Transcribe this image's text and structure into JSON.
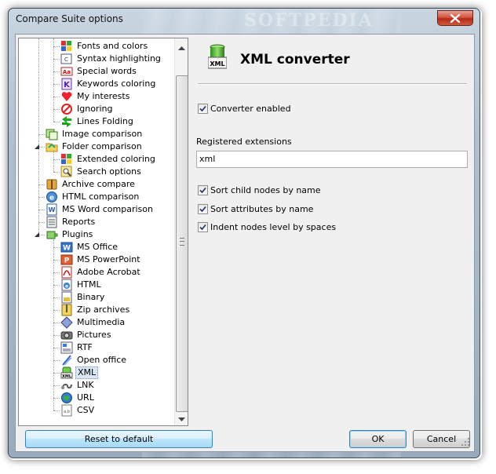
{
  "window": {
    "title": "Compare Suite options",
    "watermark": "SOFTPEDIA"
  },
  "tree": {
    "items": [
      {
        "label": "Fonts and colors",
        "icon": "palette-icon",
        "level": 2
      },
      {
        "label": "Syntax highlighting",
        "icon": "syntax-icon",
        "level": 2
      },
      {
        "label": "Special words",
        "icon": "special-words-icon",
        "level": 2
      },
      {
        "label": "Keywords coloring",
        "icon": "keywords-icon",
        "level": 2
      },
      {
        "label": "My interests",
        "icon": "heart-icon",
        "level": 2
      },
      {
        "label": "Ignoring",
        "icon": "ignore-icon",
        "level": 2
      },
      {
        "label": "Lines Folding",
        "icon": "folding-arrows-icon",
        "level": 2
      },
      {
        "label": "Image comparison",
        "icon": "image-compare-icon",
        "level": 1
      },
      {
        "label": "Folder comparison",
        "icon": "folder-compare-icon",
        "level": 1,
        "expanded": true
      },
      {
        "label": "Extended coloring",
        "icon": "palette-icon",
        "level": 2
      },
      {
        "label": "Search options",
        "icon": "search-options-icon",
        "level": 2
      },
      {
        "label": "Archive compare",
        "icon": "archive-icon",
        "level": 1
      },
      {
        "label": "HTML comparison",
        "icon": "html-compare-icon",
        "level": 1
      },
      {
        "label": "MS Word comparison",
        "icon": "word-compare-icon",
        "level": 1
      },
      {
        "label": "Reports",
        "icon": "reports-icon",
        "level": 1
      },
      {
        "label": "Plugins",
        "icon": "plugins-icon",
        "level": 1,
        "expanded": true
      },
      {
        "label": "MS Office",
        "icon": "ms-office-icon",
        "level": 2
      },
      {
        "label": "MS PowerPoint",
        "icon": "powerpoint-icon",
        "level": 2
      },
      {
        "label": "Adobe Acrobat",
        "icon": "acrobat-icon",
        "level": 2
      },
      {
        "label": "HTML",
        "icon": "html-icon",
        "level": 2
      },
      {
        "label": "Binary",
        "icon": "binary-icon",
        "level": 2
      },
      {
        "label": "Zip archives",
        "icon": "zip-icon",
        "level": 2
      },
      {
        "label": "Multimedia",
        "icon": "multimedia-icon",
        "level": 2
      },
      {
        "label": "Pictures",
        "icon": "pictures-icon",
        "level": 2
      },
      {
        "label": "RTF",
        "icon": "rtf-icon",
        "level": 2
      },
      {
        "label": "Open office",
        "icon": "open-office-icon",
        "level": 2
      },
      {
        "label": "XML",
        "icon": "xml-icon",
        "level": 2,
        "selected": true
      },
      {
        "label": "LNK",
        "icon": "lnk-icon",
        "level": 2
      },
      {
        "label": "URL",
        "icon": "globe-icon",
        "level": 2
      },
      {
        "label": "CSV",
        "icon": "csv-icon",
        "level": 2
      }
    ]
  },
  "panel": {
    "title": "XML converter",
    "icon_text": "XML",
    "converter_enabled": {
      "label": "Converter enabled",
      "checked": true
    },
    "extensions_label": "Registered extensions",
    "extensions_value": "xml",
    "sort_child": {
      "label": "Sort child nodes by name",
      "checked": true
    },
    "sort_attributes": {
      "label": "Sort attributes by name",
      "checked": true
    },
    "indent_nodes": {
      "label": "Indent nodes level by spaces",
      "checked": true
    }
  },
  "buttons": {
    "reset": "Reset to default",
    "ok": "OK",
    "cancel": "Cancel"
  }
}
